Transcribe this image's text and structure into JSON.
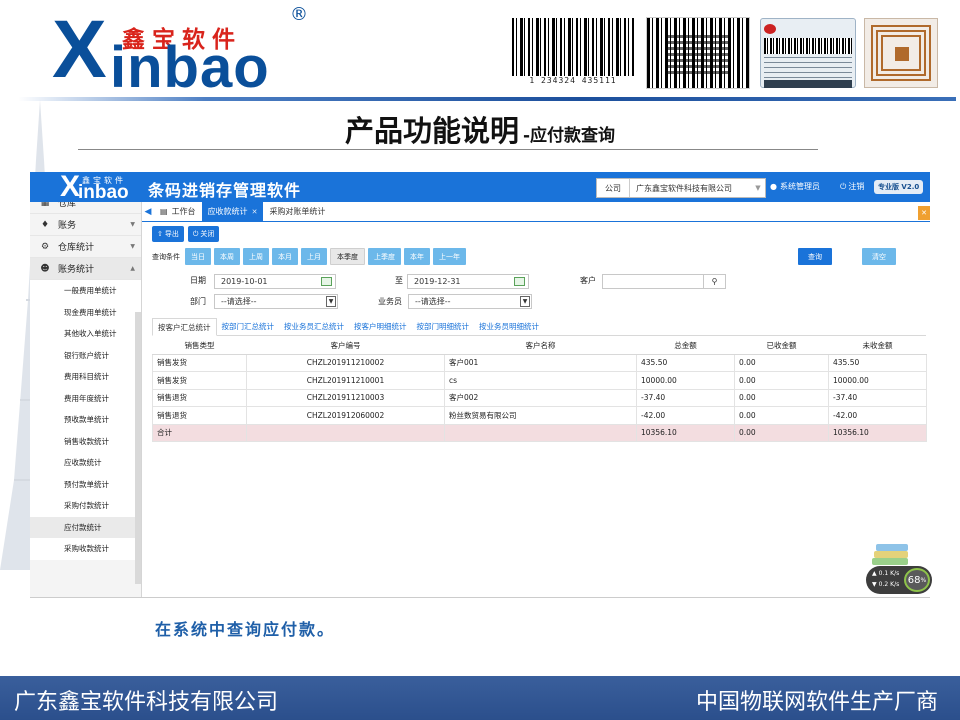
{
  "header": {
    "brand_x": "X",
    "brand_inbao": "inbao",
    "brand_cn": "鑫宝软件",
    "brand_reg": "®",
    "barcode_digits": "1 234324 435111"
  },
  "slide": {
    "title": "产品功能说明",
    "subtitle": "-应付款查询",
    "caption": "在系统中查询应付款。"
  },
  "app": {
    "logo_x": "X",
    "logo_inbao": "inbao",
    "logo_cn": "鑫宝软件",
    "title": "条码进销存管理软件",
    "company_label": "公司",
    "company_value": "广东鑫宝软件科技有限公司",
    "user": "系统管理员",
    "logout": "注销",
    "version": "专业版 V2.0"
  },
  "sidebar": {
    "items": [
      {
        "label": "仓库",
        "icon": "warehouse-icon"
      },
      {
        "label": "账务",
        "icon": "finance-icon"
      },
      {
        "label": "仓库统计",
        "icon": "gear-icon"
      },
      {
        "label": "账务统计",
        "icon": "user-icon"
      }
    ],
    "subitems": [
      "一般费用单统计",
      "现金费用单统计",
      "其他收入单统计",
      "银行账户统计",
      "费用科目统计",
      "费用年度统计",
      "预收款单统计",
      "销售收款统计",
      "应收款统计",
      "预付款单统计",
      "采购付款统计",
      "应付款统计",
      "采购收款统计"
    ],
    "active_subitem": "应付款统计"
  },
  "tabs": {
    "workbench": "工作台",
    "items": [
      "应收款统计",
      "采购对账单统计"
    ]
  },
  "toolbar": {
    "export": "导出",
    "close": "关闭"
  },
  "conditions": {
    "label": "查询条件",
    "periods": [
      "当日",
      "本周",
      "上周",
      "本月",
      "上月",
      "本季度",
      "上季度",
      "本年",
      "上一年"
    ],
    "selected": "本季度",
    "query": "查询",
    "clear": "清空"
  },
  "filters": {
    "date_label": "日期",
    "date_from": "2019-10-01",
    "to_label": "至",
    "date_to": "2019-12-31",
    "customer_label": "客户",
    "customer_value": "",
    "dept_label": "部门",
    "dept_value": "--请选择--",
    "staff_label": "业务员",
    "staff_value": "--请选择--"
  },
  "subtabs": [
    "按客户汇总统计",
    "按部门汇总统计",
    "按业务员汇总统计",
    "按客户明细统计",
    "按部门明细统计",
    "按业务员明细统计"
  ],
  "table": {
    "headers": [
      "销售类型",
      "客户编号",
      "客户名称",
      "总金额",
      "已收金额",
      "未收金额"
    ],
    "rows": [
      [
        "销售发货",
        "CHZL201911210002",
        "客户001",
        "435.50",
        "0.00",
        "435.50"
      ],
      [
        "销售发货",
        "CHZL201911210001",
        "cs",
        "10000.00",
        "0.00",
        "10000.00"
      ],
      [
        "销售退货",
        "CHZL201911210003",
        "客户002",
        "-37.40",
        "0.00",
        "-37.40"
      ],
      [
        "销售退货",
        "CHZL201912060002",
        "粉丝数贸易有限公司",
        "-42.00",
        "0.00",
        "-42.00"
      ]
    ],
    "total": [
      "合计",
      "",
      "",
      "10356.10",
      "0.00",
      "10356.10"
    ]
  },
  "widget": {
    "up": "0.1",
    "down": "0.2",
    "unit": "K/s",
    "percent": "68",
    "percent_sign": "%"
  },
  "footer": {
    "left": "广东鑫宝软件科技有限公司",
    "right": "中国物联网软件生产厂商"
  }
}
